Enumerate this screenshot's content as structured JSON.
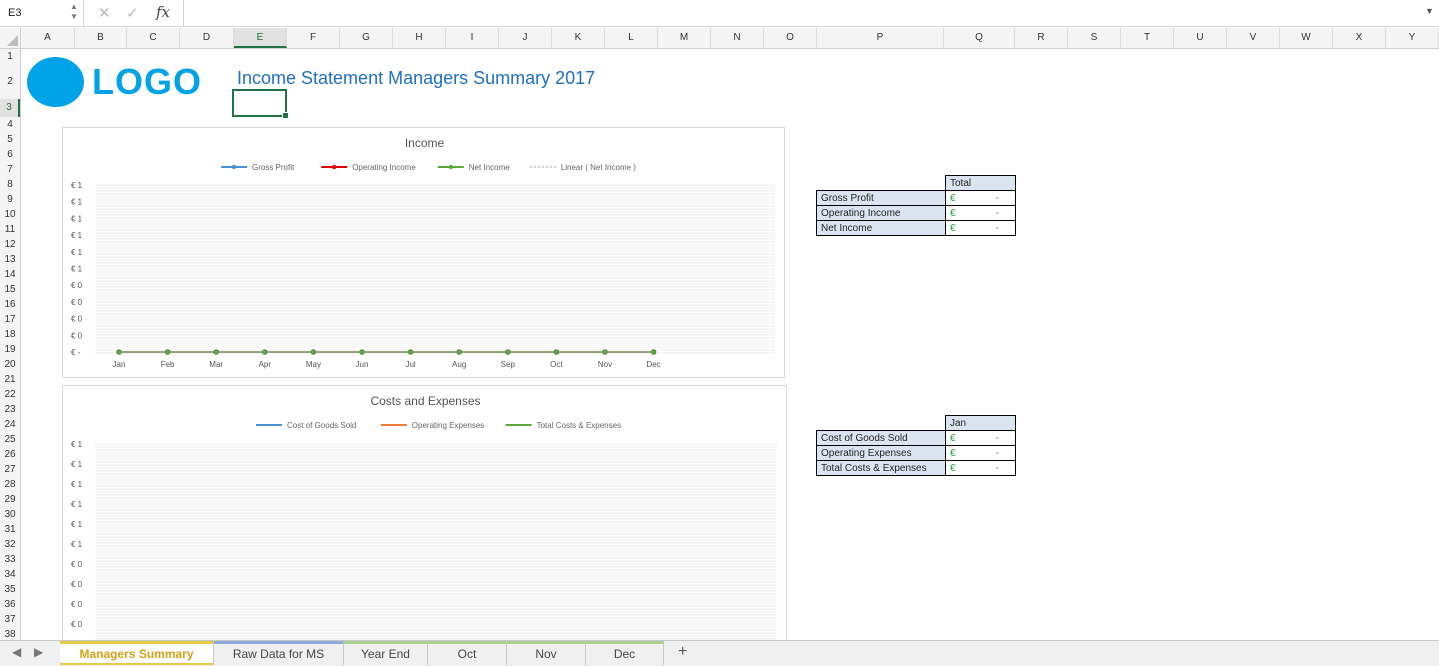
{
  "formula_bar": {
    "cell_ref": "E3",
    "cancel_icon": "✕",
    "enter_icon": "✓",
    "fx": "fx",
    "formula": ""
  },
  "columns": [
    "A",
    "B",
    "C",
    "D",
    "E",
    "F",
    "G",
    "H",
    "I",
    "J",
    "K",
    "L",
    "M",
    "N",
    "O",
    "P",
    "Q",
    "R",
    "S",
    "T",
    "U",
    "V",
    "W",
    "X",
    "Y"
  ],
  "selected_column": "E",
  "rows": [
    "1",
    "2",
    "3",
    "4",
    "5",
    "6",
    "7",
    "8",
    "9",
    "10",
    "11",
    "12",
    "13",
    "14",
    "15",
    "16",
    "17",
    "18",
    "19",
    "20",
    "21",
    "22",
    "23",
    "24",
    "25",
    "26",
    "27",
    "28",
    "29",
    "30",
    "31",
    "32",
    "33",
    "34",
    "35",
    "36",
    "37",
    "38"
  ],
  "selected_row": "3",
  "sheet": {
    "logo_text": "LOGO",
    "title": "Income Statement Managers Summary 2017",
    "logo_color": "#00a2e8",
    "title_color": "#1f6fbf"
  },
  "chart_data": [
    {
      "type": "line",
      "title": "Income",
      "categories": [
        "Jan",
        "Feb",
        "Mar",
        "Apr",
        "May",
        "Jun",
        "Jul",
        "Aug",
        "Sep",
        "Oct",
        "Nov",
        "Dec"
      ],
      "y_tick_labels": [
        "€ 1",
        "€ 1",
        "€ 1",
        "€ 1",
        "€ 1",
        "€ 1",
        "€ 0",
        "€ 0",
        "€ 0",
        "€ 0",
        "€ -"
      ],
      "ylim": [
        0,
        1
      ],
      "grid": true,
      "legend_position": "top",
      "series": [
        {
          "name": "Gross Profit",
          "color": "#4a90d9",
          "marker": true,
          "values": [
            0,
            0,
            0,
            0,
            0,
            0,
            0,
            0,
            0,
            0,
            0,
            0
          ]
        },
        {
          "name": "Operating Income",
          "color": "#e00000",
          "marker": true,
          "values": [
            0,
            0,
            0,
            0,
            0,
            0,
            0,
            0,
            0,
            0,
            0,
            0
          ]
        },
        {
          "name": "Net Income",
          "color": "#5aa83c",
          "marker": true,
          "values": [
            0,
            0,
            0,
            0,
            0,
            0,
            0,
            0,
            0,
            0,
            0,
            0
          ]
        },
        {
          "name": "Linear ( Net Income )",
          "color": "#9a9a9a",
          "dashed": true,
          "values": [
            0,
            0,
            0,
            0,
            0,
            0,
            0,
            0,
            0,
            0,
            0,
            0
          ]
        }
      ]
    },
    {
      "type": "line",
      "title": "Costs and Expenses",
      "categories": [],
      "y_tick_labels": [
        "€ 1",
        "€ 1",
        "€ 1",
        "€ 1",
        "€ 1",
        "€ 1",
        "€ 0",
        "€ 0",
        "€ 0",
        "€ 0"
      ],
      "grid": true,
      "legend_position": "top",
      "series": [
        {
          "name": "Cost of Goods Sold",
          "color": "#4a90d9",
          "values": []
        },
        {
          "name": "Operating Expenses",
          "color": "#ed7d31",
          "values": []
        },
        {
          "name": "Total Costs & Expenses",
          "color": "#5aa83c",
          "values": []
        }
      ]
    }
  ],
  "income_table": {
    "header": "Total",
    "rows": [
      {
        "label": "Gross Profit",
        "currency": "€",
        "value": "-"
      },
      {
        "label": "Operating Income",
        "currency": "€",
        "value": "-"
      },
      {
        "label": "Net Income",
        "currency": "€",
        "value": "-"
      }
    ]
  },
  "costs_table": {
    "header": "Jan",
    "rows": [
      {
        "label": "Cost of Goods Sold",
        "currency": "€",
        "value": "-"
      },
      {
        "label": "Operating Expenses",
        "currency": "€",
        "value": "-"
      },
      {
        "label": "Total Costs & Expenses",
        "currency": "€",
        "value": "-"
      }
    ]
  },
  "tabs": [
    {
      "label": "Managers Summary",
      "active": true,
      "color": "#e6c84a"
    },
    {
      "label": "Raw Data for MS",
      "active": false,
      "color": "#8ea9db"
    },
    {
      "label": "Year End",
      "active": false,
      "color": "#a9d08e"
    },
    {
      "label": "Oct",
      "active": false,
      "color": "#a9d08e"
    },
    {
      "label": "Nov",
      "active": false,
      "color": "#a9d08e"
    },
    {
      "label": "Dec",
      "active": false,
      "color": "#a9d08e"
    }
  ],
  "tab_nav": {
    "prev": "◀",
    "next": "▶",
    "add": "+"
  }
}
